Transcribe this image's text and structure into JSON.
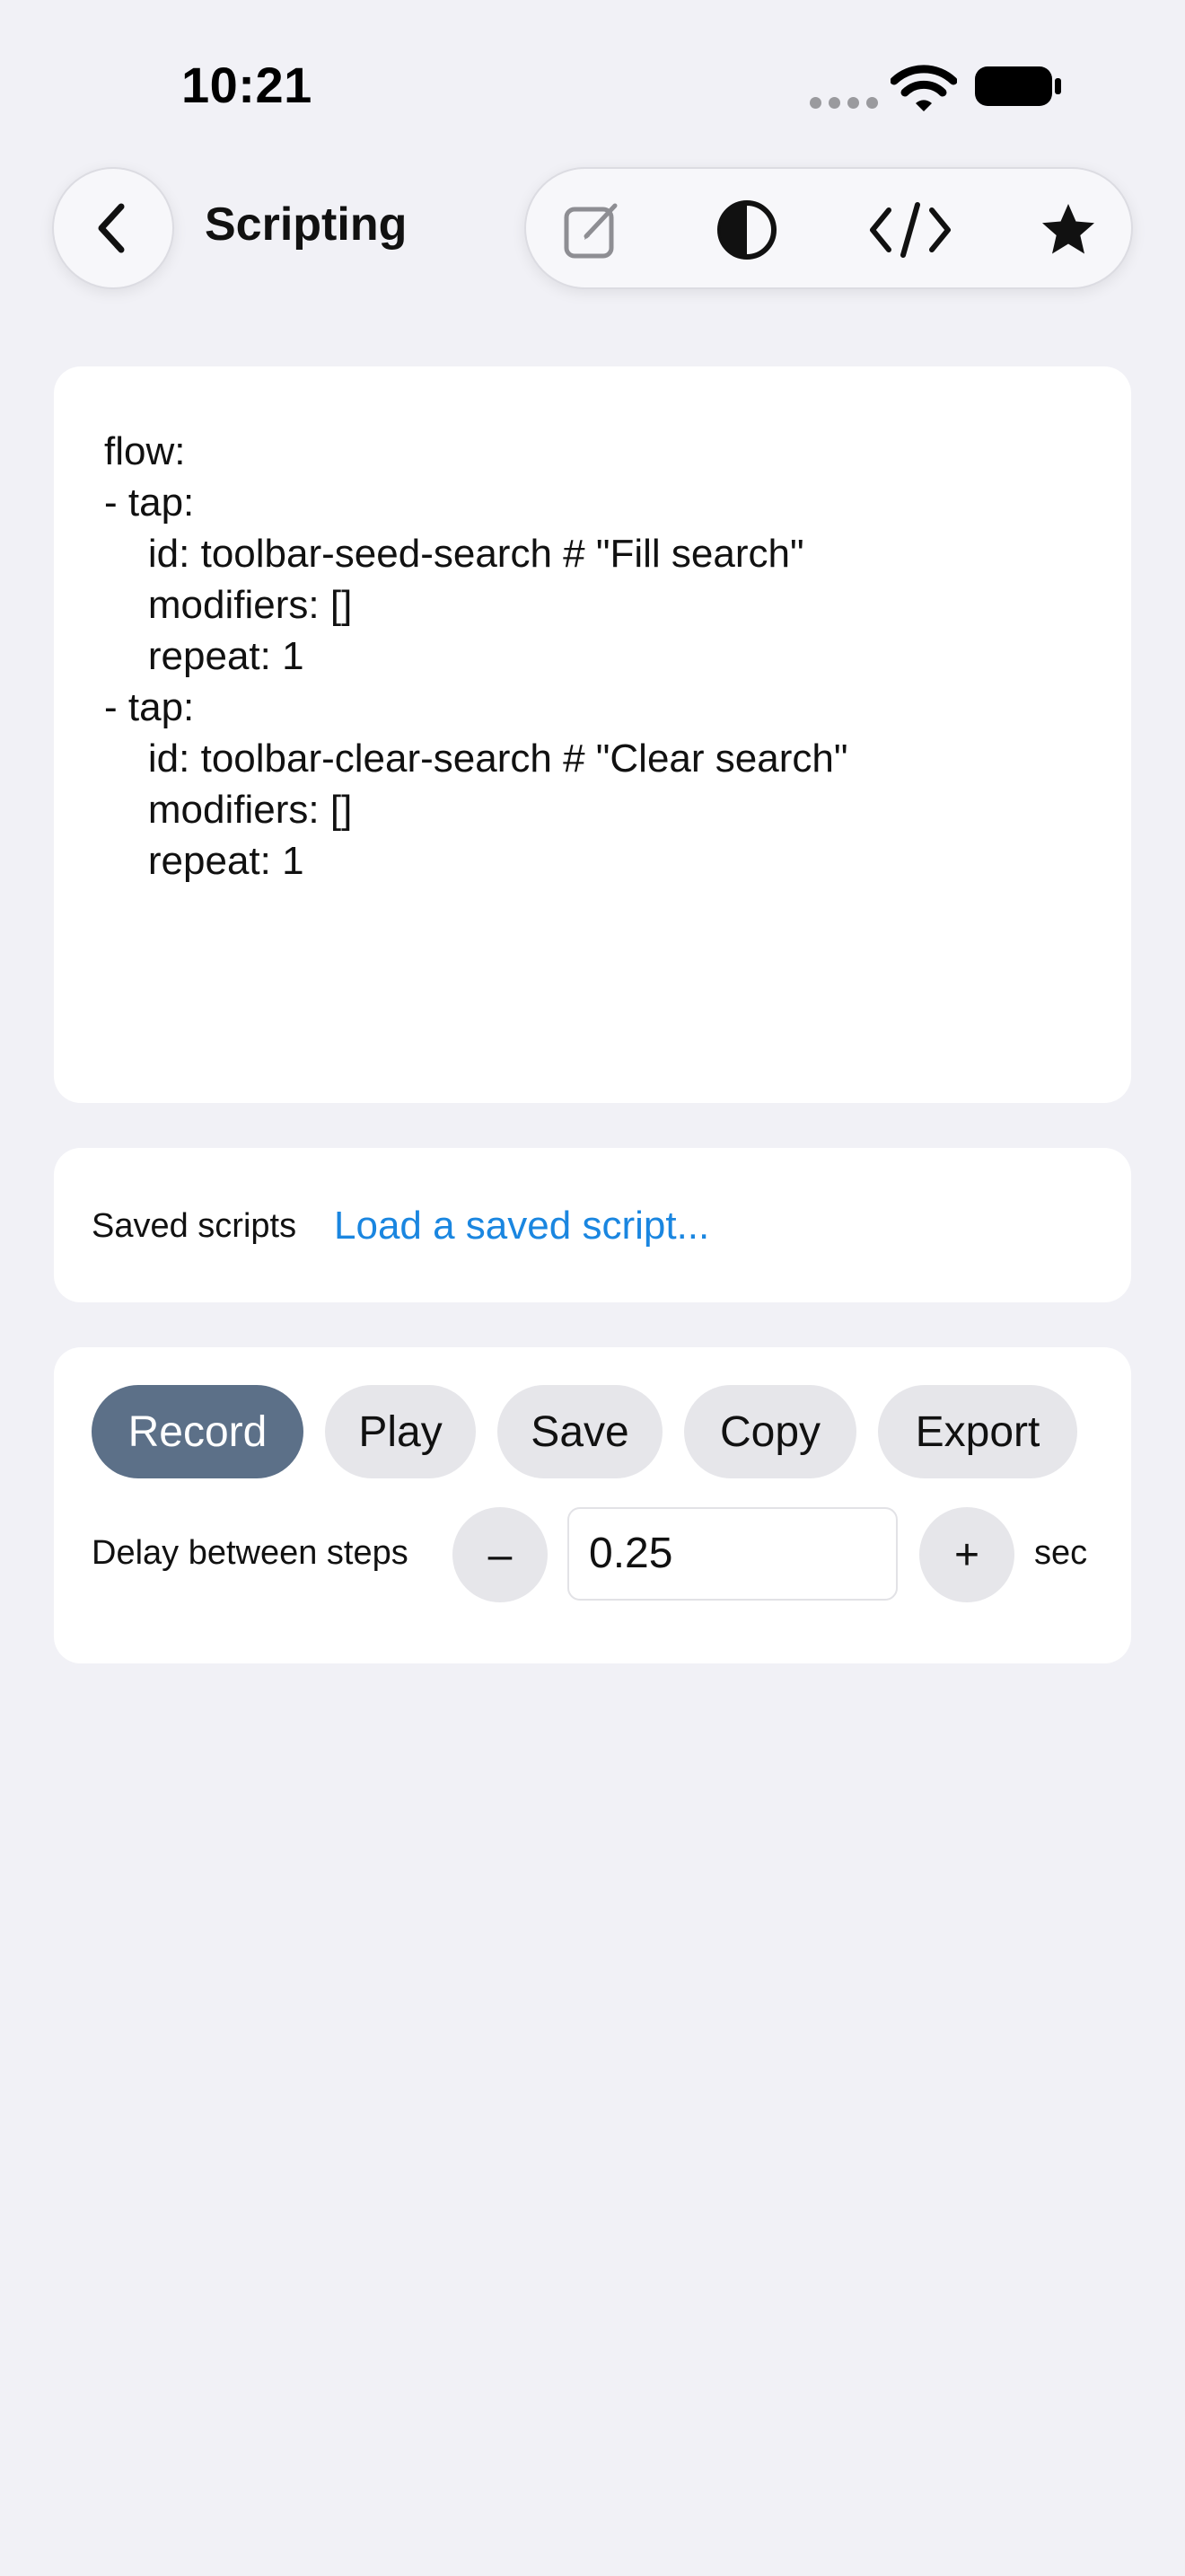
{
  "status_bar": {
    "time": "10:21",
    "icons": [
      "cellular-dots-icon",
      "wifi-icon",
      "battery-icon"
    ]
  },
  "nav": {
    "title": "Scripting",
    "back_icon": "chevron-left-icon",
    "toolbar_icons": [
      "compose-icon",
      "contrast-icon",
      "code-icon",
      "star-icon"
    ]
  },
  "editor": {
    "lines": [
      "flow:",
      "- tap:",
      "    id: toolbar-seed-search # \"Fill search\"",
      "    modifiers: []",
      "    repeat: 1",
      "- tap:",
      "    id: toolbar-clear-search # \"Clear search\"",
      "    modifiers: []",
      "    repeat: 1"
    ]
  },
  "saved_scripts": {
    "label": "Saved scripts",
    "link_text": "Load a saved script..."
  },
  "controls": {
    "buttons": {
      "record": "Record",
      "play": "Play",
      "save": "Save",
      "copy": "Copy",
      "export": "Export"
    },
    "delay": {
      "label": "Delay between steps",
      "decrement": "–",
      "value": "0.25",
      "increment": "+",
      "unit": "sec"
    }
  },
  "colors": {
    "background": "#f1f1f6",
    "card": "#ffffff",
    "accent_link": "#1a86e0",
    "record_button": "#5c7088",
    "secondary_button": "#e6e6ea"
  }
}
